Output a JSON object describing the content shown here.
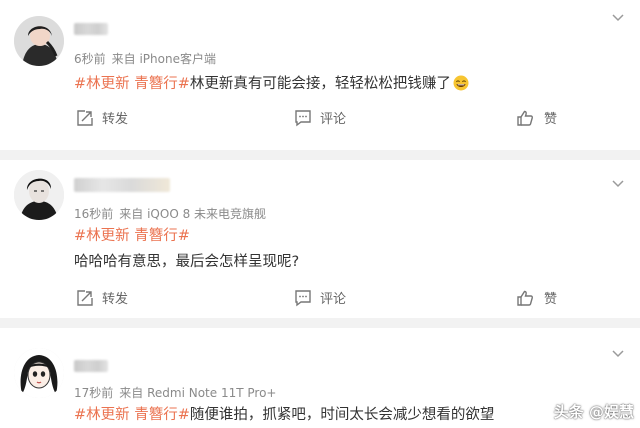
{
  "colors": {
    "tag": "#eb7350",
    "meta": "#8a8a8a",
    "text": "#333333",
    "divider": "#f2f2f2"
  },
  "posts": [
    {
      "meta": {
        "time": "6秒前",
        "source": "来自 iPhone客户端"
      },
      "tags": [
        "#林更新",
        "青簪行#"
      ],
      "body": "林更新真有可能会接，轻轻松松把钱赚了",
      "emoji": "grinning-face-icon",
      "actions": {
        "repost": "转发",
        "comment": "评论",
        "like": "赞"
      }
    },
    {
      "meta": {
        "time": "16秒前",
        "source": "来自 iQOO 8 未来电竞旗舰"
      },
      "tags": [
        "#林更新",
        "青簪行#"
      ],
      "body": "哈哈哈有意思，最后会怎样呈现呢?",
      "actions": {
        "repost": "转发",
        "comment": "评论",
        "like": "赞"
      }
    },
    {
      "meta": {
        "time": "17秒前",
        "source": "来自 Redmi Note 11T Pro+"
      },
      "tags": [
        "#林更新",
        "青簪行#"
      ],
      "body": "随便谁拍，抓紧吧，时间太长会减少想看的欲望"
    }
  ],
  "watermark": "头条 @娱慧"
}
